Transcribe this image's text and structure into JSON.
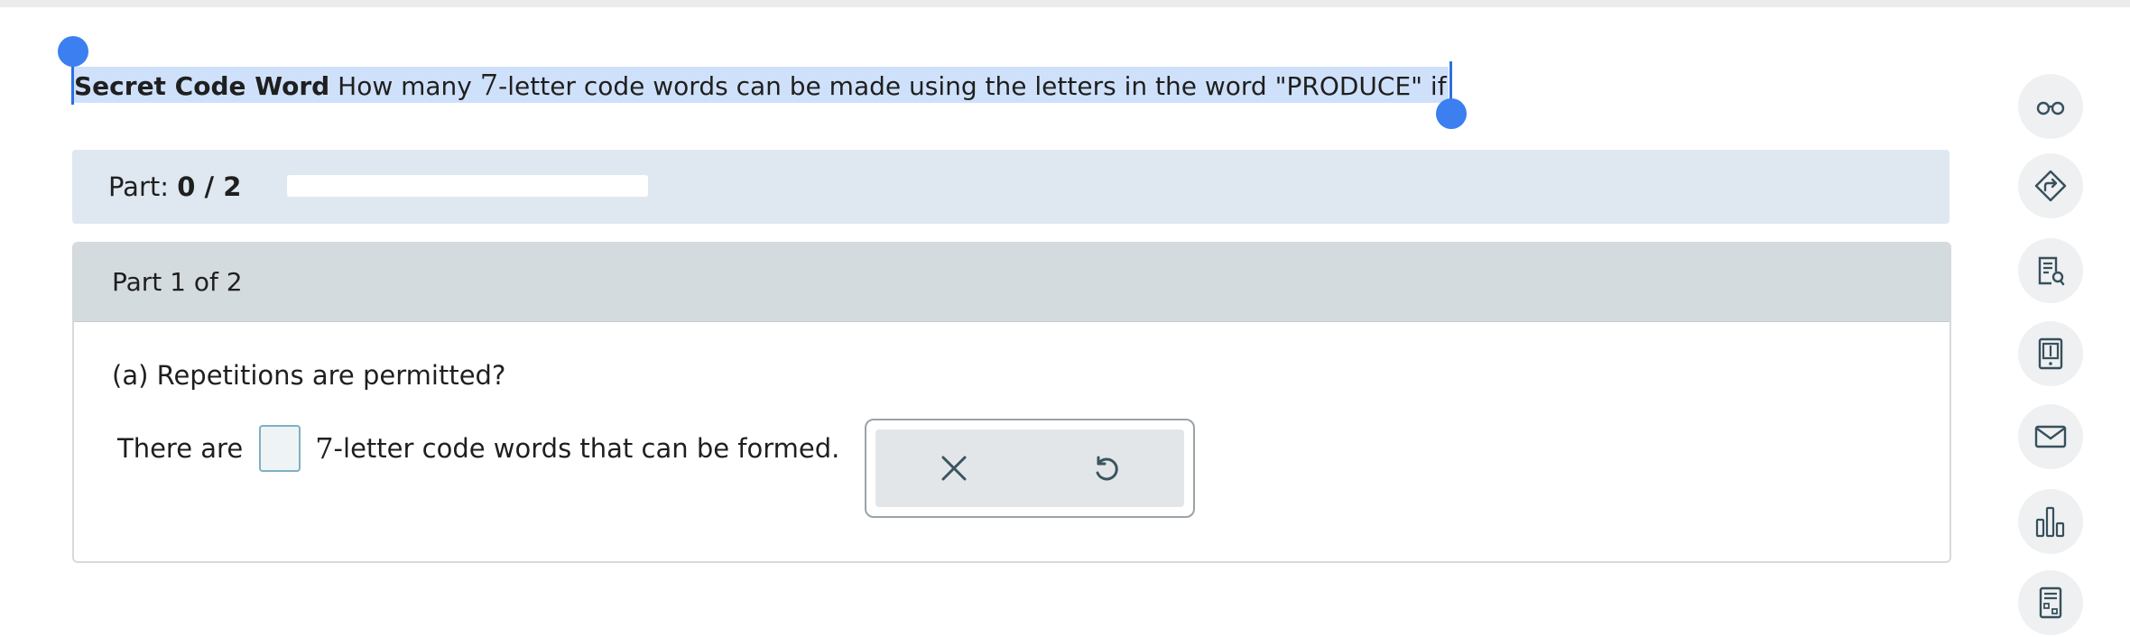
{
  "question": {
    "title": "Secret Code Word",
    "text_before": "How many ",
    "number": "7",
    "text_after": "-letter code words can be made using the letters in the word \"PRODUCE\" if"
  },
  "progress": {
    "label": "Part:",
    "value": "0 / 2",
    "fraction": 0
  },
  "part": {
    "header": "Part 1 of 2",
    "question": "(a) Repetitions are permitted?",
    "answer_prefix": "There are",
    "answer_number": "7",
    "answer_suffix": "-letter code words that can be formed."
  },
  "actions": {
    "clear_icon": "close-icon",
    "undo_icon": "undo-icon"
  },
  "toolbar": {
    "icons": [
      "glasses-icon",
      "directions-icon",
      "document-search-icon",
      "ebook-icon",
      "mail-icon",
      "bar-chart-icon",
      "calculator-icon"
    ]
  },
  "colors": {
    "selection": "#cfe1fa",
    "handle": "#3b7ff1",
    "progress_bg": "#dfe8f0",
    "card_header": "#d4dbde",
    "input_border": "#7fb0c2"
  }
}
